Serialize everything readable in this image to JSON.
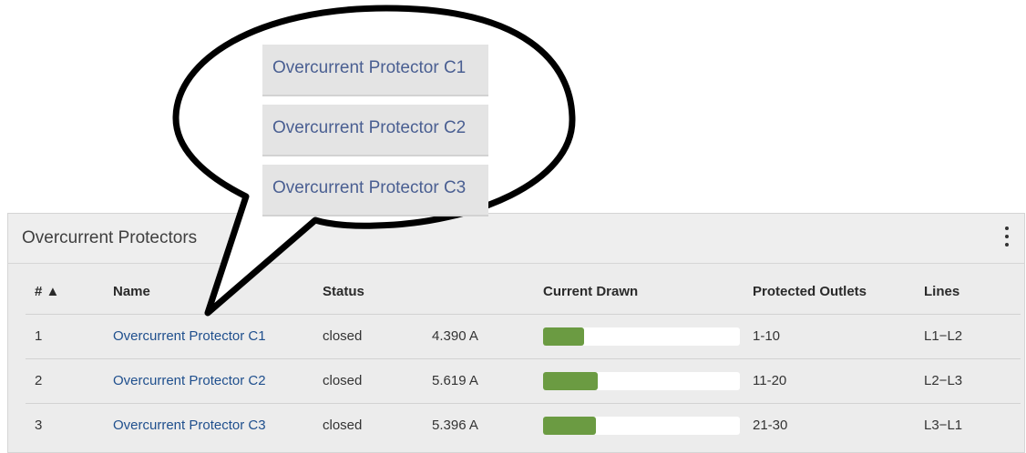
{
  "panel": {
    "title": "Overcurrent Protectors",
    "menu_icon": "vertical-ellipsis-icon"
  },
  "table": {
    "columns": {
      "index": "# ▲",
      "name": "Name",
      "status": "Status",
      "current_drawn": "Current Drawn",
      "protected_outlets": "Protected Outlets",
      "lines": "Lines"
    },
    "rows": [
      {
        "index": "1",
        "name": "Overcurrent Protector C1",
        "status": "closed",
        "current": "4.390 A",
        "fill_fraction": 0.21,
        "outlets": "1-10",
        "lines": "L1−L2"
      },
      {
        "index": "2",
        "name": "Overcurrent Protector C2",
        "status": "closed",
        "current": "5.619 A",
        "fill_fraction": 0.28,
        "outlets": "11-20",
        "lines": "L2−L3"
      },
      {
        "index": "3",
        "name": "Overcurrent Protector C3",
        "status": "closed",
        "current": "5.396 A",
        "fill_fraction": 0.27,
        "outlets": "21-30",
        "lines": "L3−L1"
      }
    ],
    "bar_color": "#6b9b42"
  },
  "callout": {
    "items": [
      "Overcurrent Protector C1",
      "Overcurrent Protector C2",
      "Overcurrent Protector C3"
    ]
  }
}
